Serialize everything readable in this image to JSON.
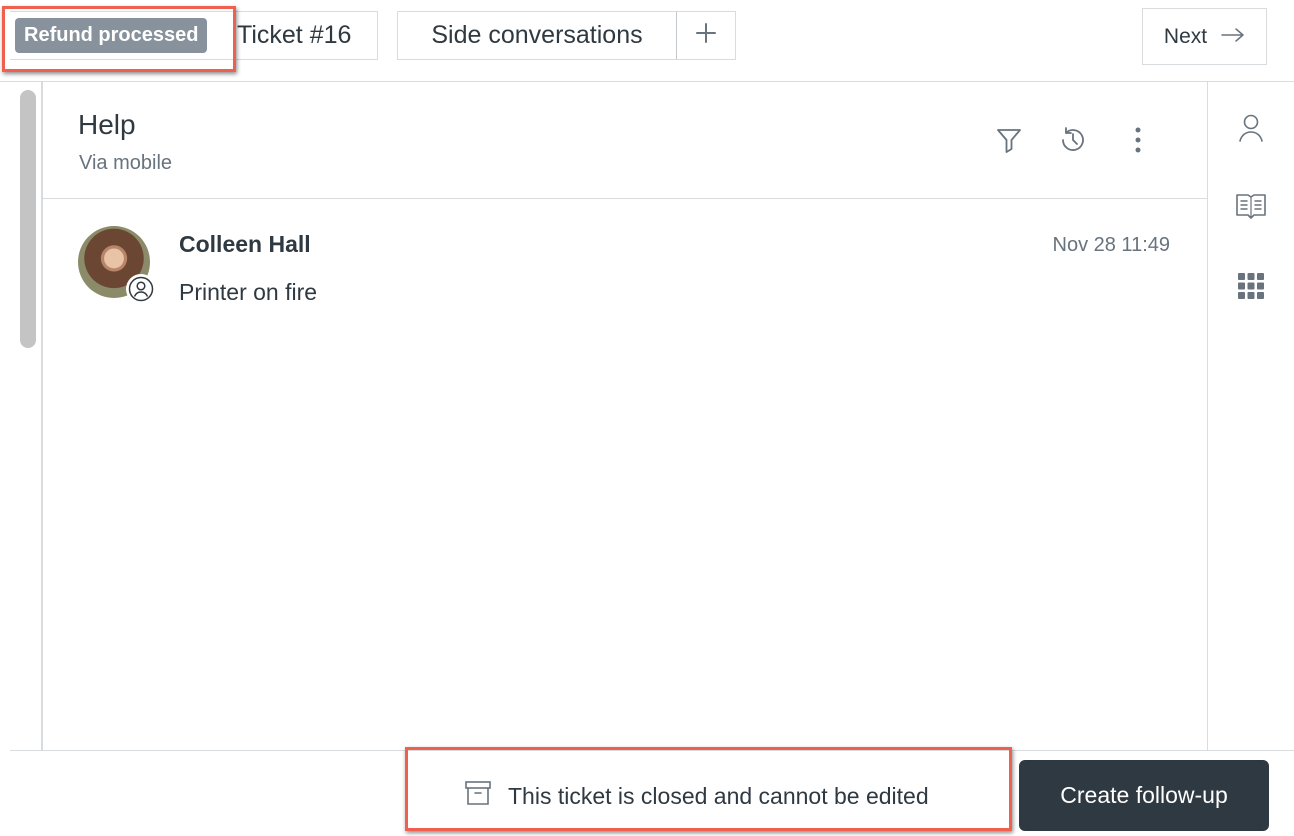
{
  "topbar": {
    "status_badge": "Refund processed",
    "ticket_tab_label": "Ticket #16",
    "side_conversations_label": "Side conversations",
    "add_tab_icon": "plus-icon",
    "next_label": "Next",
    "next_icon": "arrow-right-icon"
  },
  "conversation": {
    "title": "Help",
    "subtitle": "Via mobile",
    "header_icons": [
      "filter-icon",
      "history-icon",
      "more-vertical-icon"
    ]
  },
  "messages": [
    {
      "author": "Colleen Hall",
      "body": "Printer on fire",
      "timestamp": "Nov 28 11:49",
      "avatar_badge_icon": "end-user-icon"
    }
  ],
  "rail": {
    "icons": [
      "user-icon",
      "knowledge-book-icon",
      "apps-grid-icon"
    ]
  },
  "footer": {
    "closed_notice": "This ticket is closed and cannot be edited",
    "closed_icon": "archive-icon",
    "followup_label": "Create follow-up"
  },
  "colors": {
    "badge_bg": "#87929d",
    "primary_button_bg": "#2f3941",
    "highlight": "#f0604f",
    "text": "#2f3941",
    "muted_text": "#68737d",
    "border": "#d8dcde"
  }
}
